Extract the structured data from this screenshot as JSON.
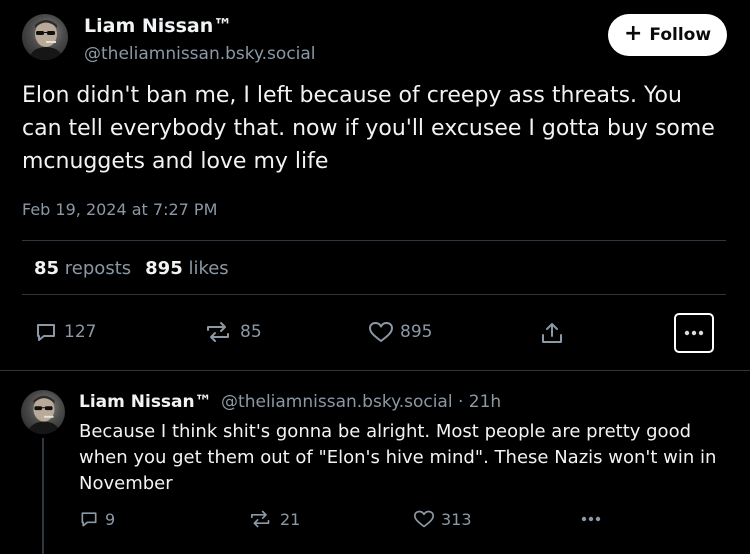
{
  "post": {
    "author_name": "Liam Nissan™",
    "author_handle": "@theliamnissan.bsky.social",
    "follow_label": "Follow",
    "text_lines": [
      "Elon didn't ban me, I left because of creepy ass threats. You",
      "can tell everybody that. now if you'll excusee I gotta buy some",
      "mcnuggets and love my life"
    ],
    "timestamp": "Feb 19, 2024 at 7:27 PM",
    "stats": {
      "reposts_count": "85",
      "reposts_label": "reposts",
      "likes_count": "895",
      "likes_label": "likes"
    },
    "actions": {
      "reply_count": "127",
      "repost_count": "85",
      "like_count": "895"
    }
  },
  "reply": {
    "author_name": "Liam Nissan™",
    "author_handle": "@theliamnissan.bsky.social",
    "separator": "·",
    "age": "21h",
    "text_lines": [
      "Because I think shit's gonna be alright. Most people are pretty good",
      "when you get them out of \"Elon's hive mind\". These Nazis won't win in",
      "November"
    ],
    "actions": {
      "reply_count": "9",
      "repost_count": "21",
      "like_count": "313"
    }
  },
  "colors": {
    "background": "#000000",
    "text": "#f1f3f5",
    "muted": "#8b98a5",
    "divider": "#2e3640",
    "button_bg": "#ffffff"
  },
  "icons": [
    "plus-icon",
    "reply-icon",
    "repost-icon",
    "like-icon",
    "share-icon",
    "more-icon"
  ]
}
